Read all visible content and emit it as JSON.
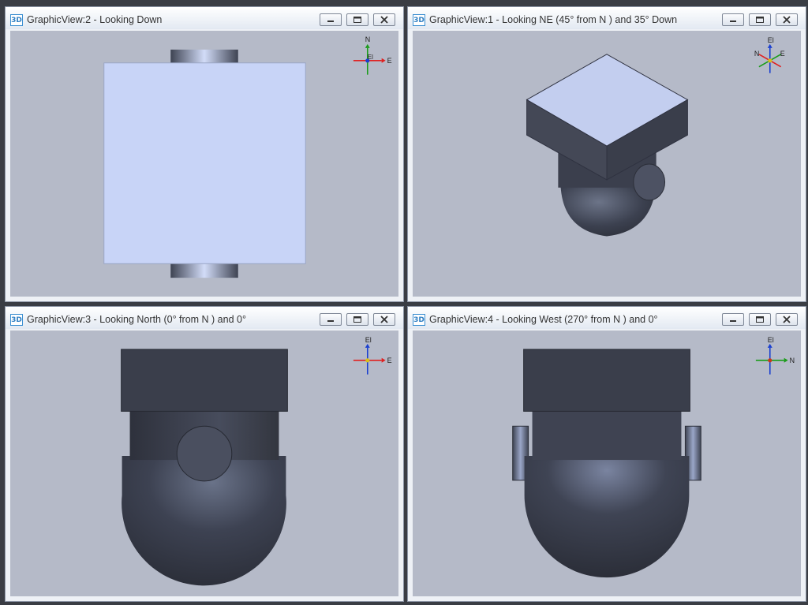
{
  "views": [
    {
      "id": "gv2",
      "icon_text": "3D",
      "title": "GraphicView:2 - Looking Down",
      "buttons": [
        "minimize-icon",
        "restore-icon",
        "close-icon"
      ],
      "axes": {
        "up": "N",
        "right": "E",
        "center": "El"
      }
    },
    {
      "id": "gv1",
      "icon_text": "3D",
      "title": "GraphicView:1 - Looking NE (45° from N ) and 35° Down",
      "buttons": [
        "minimize-icon",
        "restore-icon",
        "close-icon"
      ],
      "axes": {
        "up": "El",
        "left": "N",
        "right": "E"
      }
    },
    {
      "id": "gv3",
      "icon_text": "3D",
      "title": "GraphicView:3 - Looking North (0° from N ) and 0°",
      "buttons": [
        "minimize-icon",
        "restore-icon",
        "close-icon"
      ],
      "axes": {
        "up": "El",
        "right": "E"
      }
    },
    {
      "id": "gv4",
      "icon_text": "3D",
      "title": "GraphicView:4 - Looking West (270° from N ) and 0°",
      "buttons": [
        "minimize-icon",
        "restore-icon",
        "close-icon"
      ],
      "axes": {
        "up": "El",
        "right": "N"
      }
    }
  ],
  "colors": {
    "viewport_bg": "#b5bac8",
    "model_dark": "#3b3f4d",
    "model_light": "#c8d4f6",
    "axis_x": "#e02020",
    "axis_y": "#1a9c1a",
    "axis_z": "#1a3fd0"
  }
}
